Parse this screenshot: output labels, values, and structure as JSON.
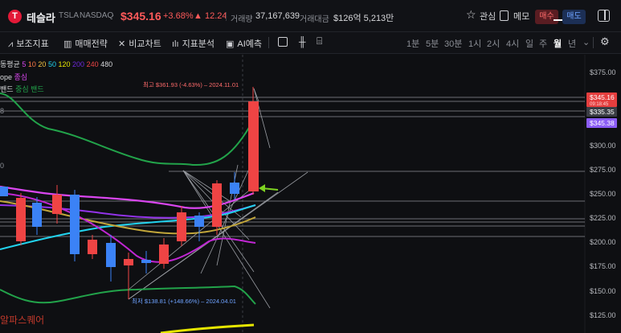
{
  "header": {
    "logo_letter": "T",
    "name": "테슬라",
    "ticker": "TSLA",
    "exchange": "NASDAQ",
    "price": "$345.16",
    "change_pct": "+3.68%",
    "change_arrow": "▲",
    "change_abs": "12.24",
    "volume_label": "거래량",
    "volume_value": "37,167,639",
    "amount_label": "거래대금",
    "amount_value": "$126억 5,213만",
    "watch_label": "관심",
    "memo_label": "메모",
    "buy_label": "매수",
    "sell_label": "매도"
  },
  "toolbar": {
    "items": [
      {
        "label": "보조지표",
        "icon": "indicator-icon"
      },
      {
        "label": "매매전략",
        "icon": "strategy-icon"
      },
      {
        "label": "비교차트",
        "icon": "compare-icon"
      },
      {
        "label": "지표분석",
        "icon": "analysis-icon"
      },
      {
        "label": "AI예측",
        "icon": "ai-icon"
      }
    ],
    "periods": [
      "1분",
      "5분",
      "30분",
      "1시",
      "2시",
      "4시",
      "일",
      "주",
      "월",
      "년"
    ],
    "active_period": "월"
  },
  "legend": {
    "ma_label": "동평균",
    "ma_values": [
      "5",
      "10",
      "20",
      "50",
      "120",
      "200",
      "240",
      "480"
    ],
    "envelope_label": "ope",
    "envelope_value": "종심",
    "band_label": "밴드",
    "band_value": "중심 밴드"
  },
  "annotations": {
    "high": "최고 $361.93 (-4.63%) – 2024.11.01",
    "low": "최저 $138.81 (+148.66%) – 2024.04.01",
    "edge_mark_a": "0",
    "edge_mark_b": "8"
  },
  "price_axis": {
    "ticks": [
      "$375.00",
      "$300.00",
      "$275.00",
      "$250.00",
      "$225.00",
      "$200.00",
      "$175.00",
      "$150.00",
      "$125.00"
    ],
    "tags": [
      {
        "label": "$345.16",
        "sub": "09:18:45",
        "color": "#e53e3e"
      },
      {
        "label": "$335.35",
        "color": "#3a3d44"
      },
      {
        "label": "$345.38",
        "color": "#8b5cf6"
      }
    ]
  },
  "watermark": "알파스퀘어",
  "colors": {
    "up": "#ef4444",
    "down": "#3b82f6",
    "accent_red": "#ff5a5a",
    "band_green": "#22a34a",
    "ma_magenta": "#d946ef",
    "ma_cyan": "#22d3ee",
    "ma_yellow": "#e6e600",
    "arrow_green": "#7ed321"
  }
}
